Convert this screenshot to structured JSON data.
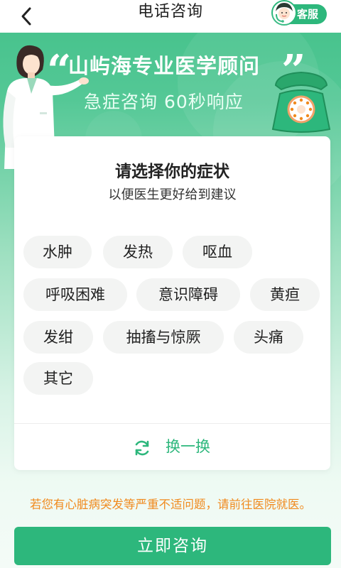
{
  "header": {
    "title": "电话咨询",
    "service_label": "客服"
  },
  "banner": {
    "title": "山屿海专业医学顾问",
    "subtitle": "急症咨询 60秒响应"
  },
  "card": {
    "title": "请选择你的症状",
    "subtitle": "以便医生更好给到建议",
    "symptoms": [
      "水肿",
      "发热",
      "呕血",
      "呼吸困难",
      "意识障碍",
      "黄疸",
      "发绀",
      "抽搐与惊厥",
      "头痛",
      "其它"
    ],
    "refresh_label": "换一换"
  },
  "footer": {
    "warning": "若您有心脏病突发等严重不适问题，请前往医院就医。",
    "consult_button": "立即咨询"
  },
  "colors": {
    "accent": "#2db77c",
    "warning": "#f08a1e",
    "chip_bg": "#f3f4f3"
  }
}
